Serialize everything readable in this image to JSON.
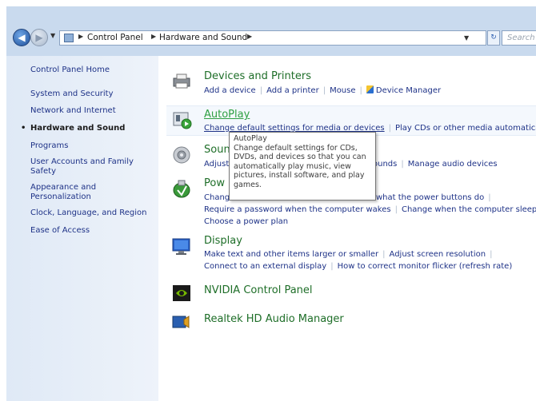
{
  "address_bar": {
    "crumbs": [
      "Control Panel",
      "Hardware and Sound"
    ],
    "search_placeholder": "Search Co"
  },
  "sidebar": {
    "home": "Control Panel Home",
    "items": [
      {
        "label": "System and Security"
      },
      {
        "label": "Network and Internet"
      },
      {
        "label": "Hardware and Sound",
        "active": true
      },
      {
        "label": "Programs"
      },
      {
        "label": "User Accounts and Family Safety"
      },
      {
        "label": "Appearance and Personalization"
      },
      {
        "label": "Clock, Language, and Region"
      },
      {
        "label": "Ease of Access"
      }
    ]
  },
  "categories": {
    "devices": {
      "title": "Devices and Printers",
      "links": [
        "Add a device",
        "Add a printer",
        "Mouse",
        "Device Manager"
      ]
    },
    "autoplay": {
      "title": "AutoPlay",
      "links": [
        "Change default settings for media or devices",
        "Play CDs or other media automatical"
      ]
    },
    "sound": {
      "title": "Soun",
      "links": [
        "Adjust",
        "ounds",
        "Manage audio devices"
      ]
    },
    "power": {
      "title": "Pow",
      "row1": [
        "Chang",
        "what the power buttons do"
      ],
      "row2": [
        "Require a password when the computer wakes",
        "Change when the computer sleeps"
      ],
      "row3": [
        "Choose a power plan"
      ]
    },
    "display": {
      "title": "Display",
      "row1": [
        "Make text and other items larger or smaller",
        "Adjust screen resolution"
      ],
      "row2": [
        "Connect to an external display",
        "How to correct monitor flicker (refresh rate)"
      ]
    },
    "nvidia": {
      "title": "NVIDIA Control Panel"
    },
    "realtek": {
      "title": "Realtek HD Audio Manager"
    }
  },
  "tooltip": {
    "title": "AutoPlay",
    "body": "Change default settings for CDs, DVDs, and devices so that you can automatically play music, view pictures, install software, and play games."
  }
}
